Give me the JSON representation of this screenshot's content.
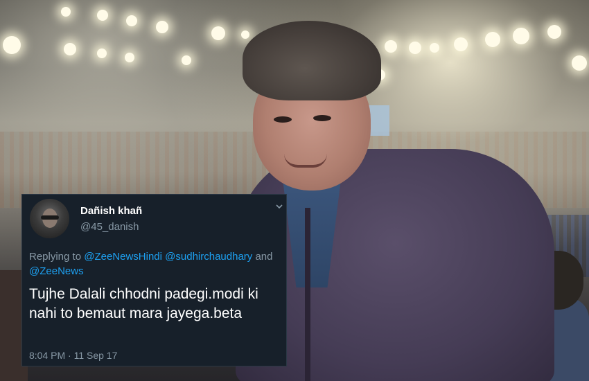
{
  "tweet": {
    "display_name": "Dañish khañ",
    "handle": "@45_danish",
    "replying_prefix": "Replying to",
    "mentions": [
      "@ZeeNewsHindi",
      "@sudhirchaudhary",
      "@ZeeNews"
    ],
    "conjunction": "and",
    "text": "Tujhe Dalali chhodni padegi.modi ki nahi to bemaut mara jayega.beta",
    "timestamp": "8:04 PM · 11 Sep 17",
    "colors": {
      "background": "#17202a",
      "name": "#ffffff",
      "secondary": "#8899a6",
      "mention": "#1da1f2"
    },
    "icons": {
      "menu": "chevron-down-icon"
    }
  }
}
